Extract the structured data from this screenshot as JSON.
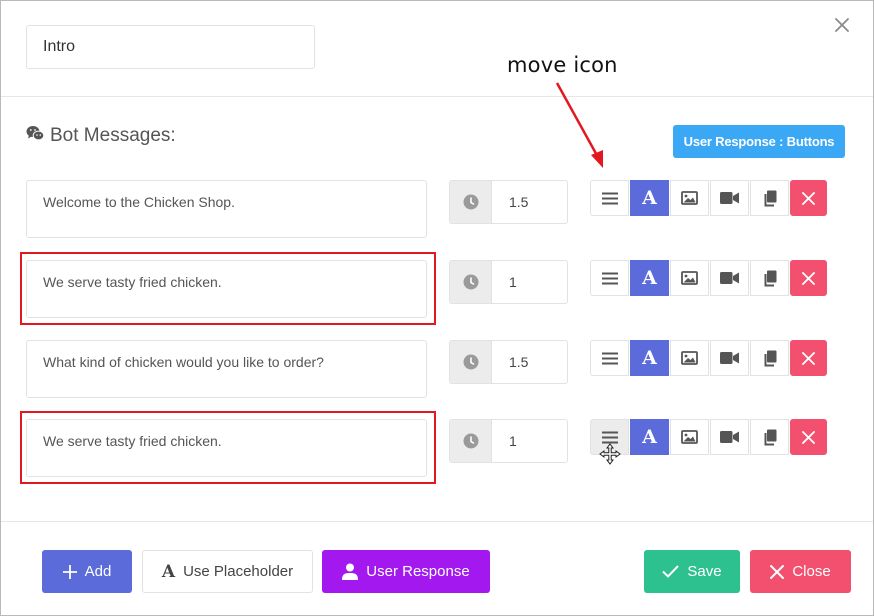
{
  "header": {
    "title_value": "Intro"
  },
  "annotation": {
    "text": "move icon"
  },
  "section": {
    "title": "Bot Messages:",
    "response_type_button": "User Response : Buttons"
  },
  "messages": [
    {
      "text": "Welcome to the Chicken Shop.",
      "delay": "1.5",
      "highlighted": false
    },
    {
      "text": "We serve tasty fried chicken.",
      "delay": "1",
      "highlighted": true
    },
    {
      "text": "What kind of chicken would you like to order?",
      "delay": "1.5",
      "highlighted": false
    },
    {
      "text": "We serve tasty fried chicken.",
      "delay": "1",
      "highlighted": true
    }
  ],
  "footer": {
    "add_label": "Add",
    "placeholder_label": "Use Placeholder",
    "user_response_label": "User Response",
    "save_label": "Save",
    "close_label": "Close"
  },
  "colors": {
    "blue": "#5b6bd9",
    "red": "#f2506e",
    "purple": "#a218ef",
    "green": "#2ec190",
    "sky": "#3aa8f4",
    "highlight_red": "#e3171f"
  }
}
